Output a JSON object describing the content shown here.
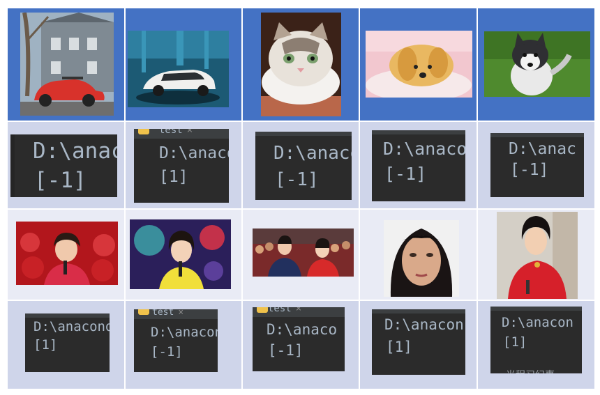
{
  "terminals": [
    {
      "line1": "D:\\anac",
      "line2": "[-1]"
    },
    {
      "tab": "test",
      "close": "×",
      "line1": "D:\\anacon",
      "line2": "[1]"
    },
    {
      "line1": "D:\\anaco",
      "line2": "[-1]"
    },
    {
      "line1": "D:\\anaco",
      "line2": "[-1]"
    },
    {
      "line1": "D:\\anac",
      "line2": "[-1]"
    },
    {
      "line1": "D:\\anacond",
      "line2": "[1]"
    },
    {
      "tab": "test",
      "close": "×",
      "line1": "D:\\anacon",
      "line2": "[-1]"
    },
    {
      "tab": "test",
      "close": "×",
      "line1": "D:\\anaco",
      "line2": "[-1]"
    },
    {
      "line1": "D:\\anacon",
      "line2": "[1]"
    },
    {
      "line1": "D:\\anacon",
      "line2": "[1]",
      "watermark": "光程习纪事"
    }
  ],
  "photos": {
    "row1": [
      "red-beetle-car-photo",
      "white-electric-car-photo",
      "kitten-photo",
      "puppy-photo",
      "husky-puppy-photo"
    ],
    "row3": [
      "presenter-red-stage-photo",
      "presenter-yellow-dress-photo",
      "two-hosts-photo",
      "woman-portrait-photo",
      "woman-red-dress-photo"
    ]
  },
  "colors": {
    "header": "#4472c4",
    "row_odd": "#cfd5ea",
    "row_even": "#e9ebf5",
    "terminal_bg": "#2b2b2b",
    "terminal_text": "#a9b7c6"
  }
}
